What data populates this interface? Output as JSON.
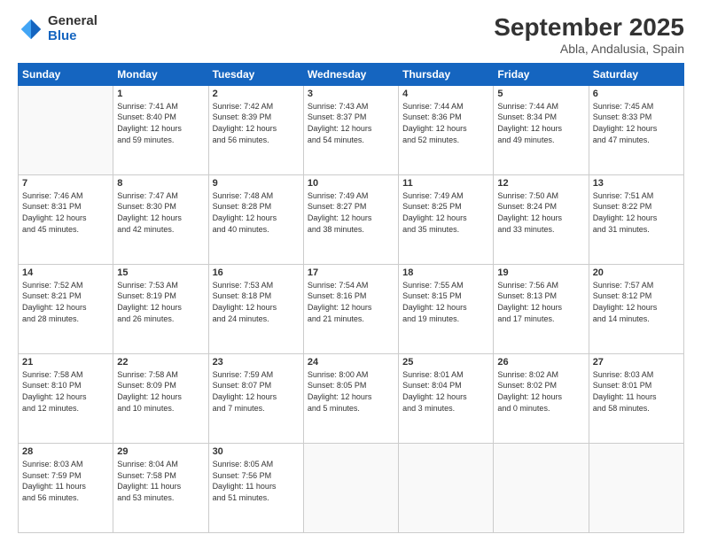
{
  "header": {
    "logo": {
      "general": "General",
      "blue": "Blue"
    },
    "title": "September 2025",
    "subtitle": "Abla, Andalusia, Spain"
  },
  "weekdays": [
    "Sunday",
    "Monday",
    "Tuesday",
    "Wednesday",
    "Thursday",
    "Friday",
    "Saturday"
  ],
  "weeks": [
    [
      {
        "day": "",
        "info": ""
      },
      {
        "day": "1",
        "info": "Sunrise: 7:41 AM\nSunset: 8:40 PM\nDaylight: 12 hours\nand 59 minutes."
      },
      {
        "day": "2",
        "info": "Sunrise: 7:42 AM\nSunset: 8:39 PM\nDaylight: 12 hours\nand 56 minutes."
      },
      {
        "day": "3",
        "info": "Sunrise: 7:43 AM\nSunset: 8:37 PM\nDaylight: 12 hours\nand 54 minutes."
      },
      {
        "day": "4",
        "info": "Sunrise: 7:44 AM\nSunset: 8:36 PM\nDaylight: 12 hours\nand 52 minutes."
      },
      {
        "day": "5",
        "info": "Sunrise: 7:44 AM\nSunset: 8:34 PM\nDaylight: 12 hours\nand 49 minutes."
      },
      {
        "day": "6",
        "info": "Sunrise: 7:45 AM\nSunset: 8:33 PM\nDaylight: 12 hours\nand 47 minutes."
      }
    ],
    [
      {
        "day": "7",
        "info": "Sunrise: 7:46 AM\nSunset: 8:31 PM\nDaylight: 12 hours\nand 45 minutes."
      },
      {
        "day": "8",
        "info": "Sunrise: 7:47 AM\nSunset: 8:30 PM\nDaylight: 12 hours\nand 42 minutes."
      },
      {
        "day": "9",
        "info": "Sunrise: 7:48 AM\nSunset: 8:28 PM\nDaylight: 12 hours\nand 40 minutes."
      },
      {
        "day": "10",
        "info": "Sunrise: 7:49 AM\nSunset: 8:27 PM\nDaylight: 12 hours\nand 38 minutes."
      },
      {
        "day": "11",
        "info": "Sunrise: 7:49 AM\nSunset: 8:25 PM\nDaylight: 12 hours\nand 35 minutes."
      },
      {
        "day": "12",
        "info": "Sunrise: 7:50 AM\nSunset: 8:24 PM\nDaylight: 12 hours\nand 33 minutes."
      },
      {
        "day": "13",
        "info": "Sunrise: 7:51 AM\nSunset: 8:22 PM\nDaylight: 12 hours\nand 31 minutes."
      }
    ],
    [
      {
        "day": "14",
        "info": "Sunrise: 7:52 AM\nSunset: 8:21 PM\nDaylight: 12 hours\nand 28 minutes."
      },
      {
        "day": "15",
        "info": "Sunrise: 7:53 AM\nSunset: 8:19 PM\nDaylight: 12 hours\nand 26 minutes."
      },
      {
        "day": "16",
        "info": "Sunrise: 7:53 AM\nSunset: 8:18 PM\nDaylight: 12 hours\nand 24 minutes."
      },
      {
        "day": "17",
        "info": "Sunrise: 7:54 AM\nSunset: 8:16 PM\nDaylight: 12 hours\nand 21 minutes."
      },
      {
        "day": "18",
        "info": "Sunrise: 7:55 AM\nSunset: 8:15 PM\nDaylight: 12 hours\nand 19 minutes."
      },
      {
        "day": "19",
        "info": "Sunrise: 7:56 AM\nSunset: 8:13 PM\nDaylight: 12 hours\nand 17 minutes."
      },
      {
        "day": "20",
        "info": "Sunrise: 7:57 AM\nSunset: 8:12 PM\nDaylight: 12 hours\nand 14 minutes."
      }
    ],
    [
      {
        "day": "21",
        "info": "Sunrise: 7:58 AM\nSunset: 8:10 PM\nDaylight: 12 hours\nand 12 minutes."
      },
      {
        "day": "22",
        "info": "Sunrise: 7:58 AM\nSunset: 8:09 PM\nDaylight: 12 hours\nand 10 minutes."
      },
      {
        "day": "23",
        "info": "Sunrise: 7:59 AM\nSunset: 8:07 PM\nDaylight: 12 hours\nand 7 minutes."
      },
      {
        "day": "24",
        "info": "Sunrise: 8:00 AM\nSunset: 8:05 PM\nDaylight: 12 hours\nand 5 minutes."
      },
      {
        "day": "25",
        "info": "Sunrise: 8:01 AM\nSunset: 8:04 PM\nDaylight: 12 hours\nand 3 minutes."
      },
      {
        "day": "26",
        "info": "Sunrise: 8:02 AM\nSunset: 8:02 PM\nDaylight: 12 hours\nand 0 minutes."
      },
      {
        "day": "27",
        "info": "Sunrise: 8:03 AM\nSunset: 8:01 PM\nDaylight: 11 hours\nand 58 minutes."
      }
    ],
    [
      {
        "day": "28",
        "info": "Sunrise: 8:03 AM\nSunset: 7:59 PM\nDaylight: 11 hours\nand 56 minutes."
      },
      {
        "day": "29",
        "info": "Sunrise: 8:04 AM\nSunset: 7:58 PM\nDaylight: 11 hours\nand 53 minutes."
      },
      {
        "day": "30",
        "info": "Sunrise: 8:05 AM\nSunset: 7:56 PM\nDaylight: 11 hours\nand 51 minutes."
      },
      {
        "day": "",
        "info": ""
      },
      {
        "day": "",
        "info": ""
      },
      {
        "day": "",
        "info": ""
      },
      {
        "day": "",
        "info": ""
      }
    ]
  ]
}
